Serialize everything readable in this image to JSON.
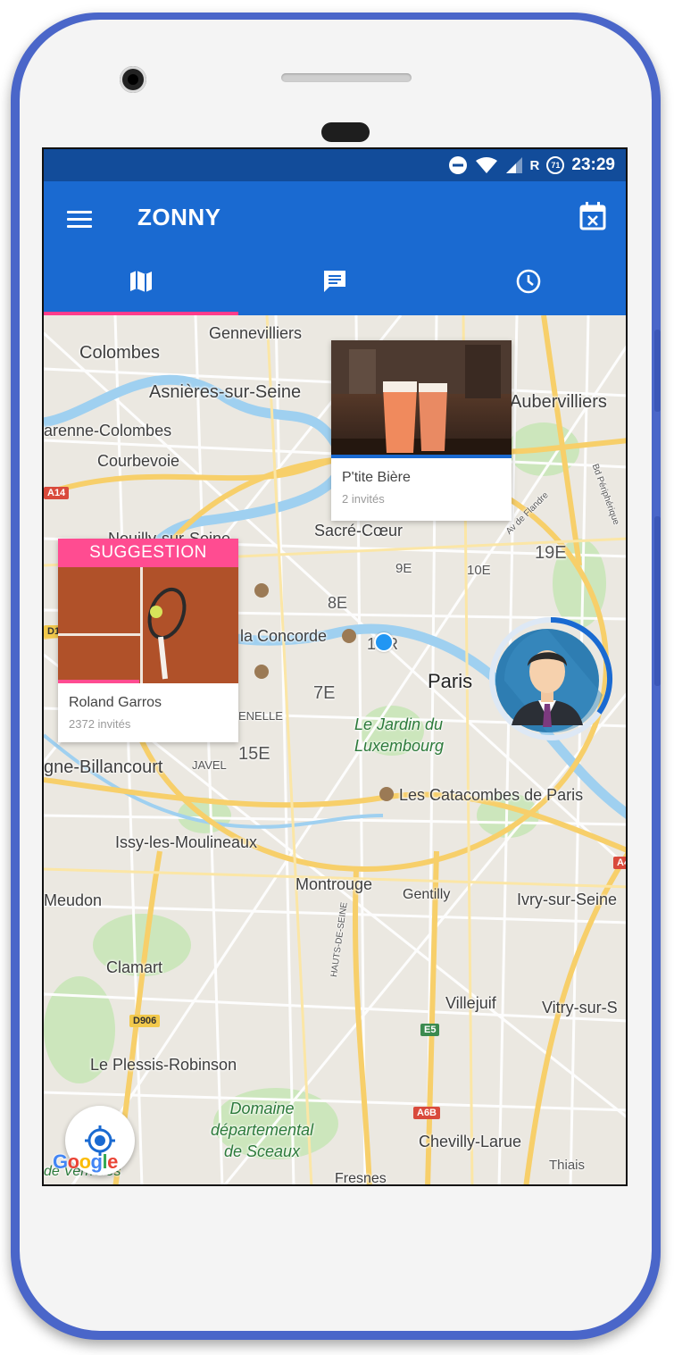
{
  "status_bar": {
    "network": "R",
    "notif_count": "71",
    "time": "23:29"
  },
  "app_bar": {
    "title": "ZONNY"
  },
  "tabs": [
    {
      "name": "map",
      "icon": "map-icon",
      "active": true
    },
    {
      "name": "chat",
      "icon": "chat-icon",
      "active": false
    },
    {
      "name": "history",
      "icon": "clock-icon",
      "active": false
    }
  ],
  "colors": {
    "primary": "#1a6ad1",
    "status": "#124c9a",
    "accent": "#ff3d8b",
    "suggestion": "#ff4c91",
    "location": "#2196f3"
  },
  "map": {
    "labels": {
      "gennevilliers": "Gennevilliers",
      "colombes": "Colombes",
      "asnieres": "Asnières-sur-Seine",
      "aubervilliers": "Aubervilliers",
      "garenne": "arenne-Colombes",
      "courbevoie": "Courbevoie",
      "neuilly": "Neuilly-sur-Seine",
      "sacre_coeur": "Sacré-Cœur",
      "arr_19": "19E",
      "arr_9": "9E",
      "arr_10": "10E",
      "arr_8": "8E",
      "concorde": "la Concorde",
      "arr_1": "1ER",
      "paris": "Paris",
      "arr_7": "7E",
      "jardin": "Le Jardin du\nLuxembourg",
      "grenelle": "ENELLE",
      "arr_15": "15E",
      "billancourt": "gne-Billancourt",
      "javel": "JAVEL",
      "catacombes": "Les Catacombes de Paris",
      "issy": "Issy-les-Moulineaux",
      "meudon": "Meudon",
      "montrouge": "Montrouge",
      "gentilly": "Gentilly",
      "ivry": "Ivry-sur-Seine",
      "clamart": "Clamart",
      "villejuif": "Villejuif",
      "vitry": "Vitry-sur-S",
      "plessis": "Le Plessis-Robinson",
      "domaine": "Domaine\ndépartemental\nde Sceaux",
      "chevilly": "Chevilly-Larue",
      "thiais": "Thiais",
      "fresnes": "Fresnes",
      "verrieres": "de Verrières",
      "hauts_seine": "HAUTS-DE-SEINE",
      "peripherique": "Bd Périphérique",
      "flandre": "Av de Flandre"
    },
    "road_badges": {
      "a14": "A14",
      "d1": "D1",
      "d906": "D906",
      "e5": "E5",
      "a6b": "A6B",
      "a4": "A4"
    },
    "google": "Google"
  },
  "events": [
    {
      "name": "P'tite Bière",
      "invites": "2 invités",
      "image": "beer-glasses",
      "progress": 1.0
    },
    {
      "name": "Roland Garros",
      "invites": "2372 invités",
      "image": "tennis-racket-clay",
      "banner": "SUGGESTION",
      "progress": 0.45
    }
  ],
  "friend_avatar": {
    "progress": 0.4
  }
}
